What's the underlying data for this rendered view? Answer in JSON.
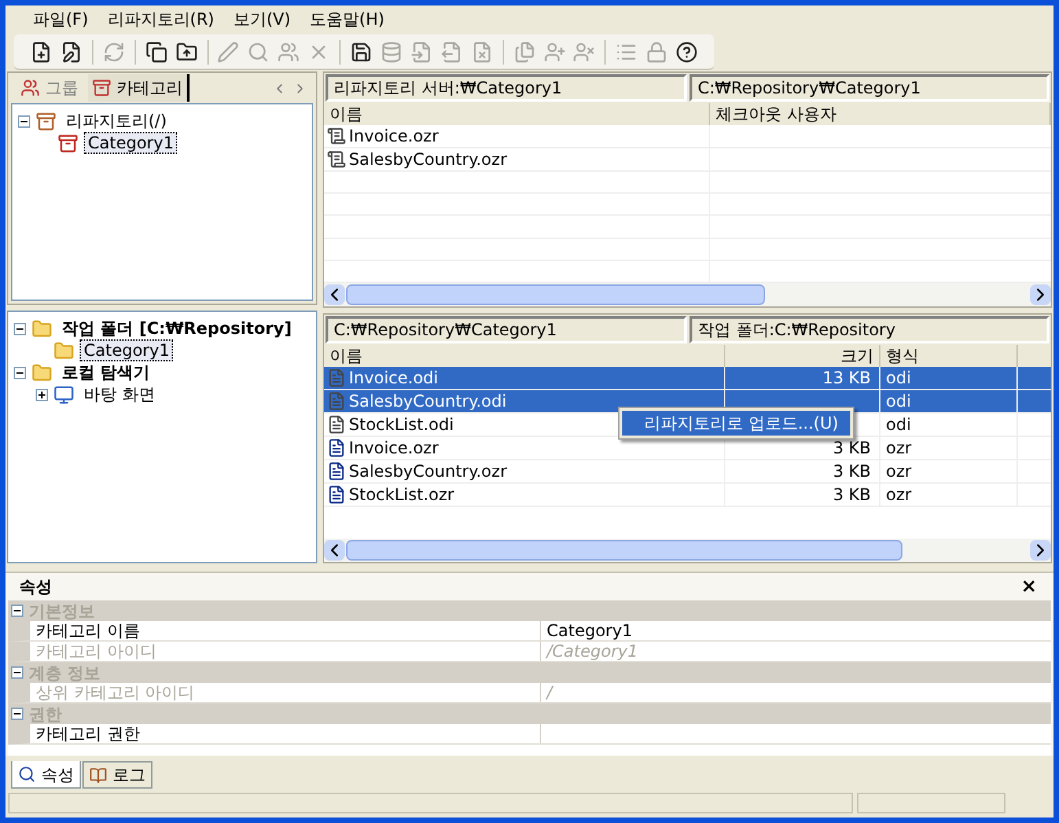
{
  "menu": [
    "파일(F)",
    "리파지토리(R)",
    "보기(V)",
    "도움말(H)"
  ],
  "toolbar": [
    [
      {
        "kind": "new",
        "disabled": false
      },
      {
        "kind": "edit",
        "disabled": false
      }
    ],
    [
      {
        "kind": "refresh",
        "disabled": true
      }
    ],
    [
      {
        "kind": "copy",
        "disabled": false
      },
      {
        "kind": "upload",
        "disabled": false
      }
    ],
    [
      {
        "kind": "pen",
        "disabled": true
      },
      {
        "kind": "find",
        "disabled": true
      },
      {
        "kind": "users",
        "disabled": true
      },
      {
        "kind": "delete",
        "disabled": true
      }
    ],
    [
      {
        "kind": "save",
        "disabled": false
      },
      {
        "kind": "database",
        "disabled": true
      },
      {
        "kind": "import",
        "disabled": true
      },
      {
        "kind": "export",
        "disabled": true
      },
      {
        "kind": "remove",
        "disabled": true
      }
    ],
    [
      {
        "kind": "files",
        "disabled": true
      },
      {
        "kind": "adduser",
        "disabled": true
      },
      {
        "kind": "removeuser",
        "disabled": true
      }
    ],
    [
      {
        "kind": "list",
        "disabled": true
      },
      {
        "kind": "lock",
        "disabled": true
      },
      {
        "kind": "help",
        "disabled": false
      }
    ]
  ],
  "left_tabs": [
    {
      "label": "그룹",
      "kind": "group",
      "selected": false
    },
    {
      "label": "카테고리",
      "kind": "category",
      "selected": true
    }
  ],
  "repository_tree": [
    {
      "label": "리파지토리(/)",
      "kind": "repository",
      "expanded": true,
      "selected": false,
      "children": [
        {
          "label": "Category1",
          "kind": "category",
          "selected": true
        }
      ]
    }
  ],
  "local_tree": [
    {
      "label": "작업 폴더 [C:₩Repository]",
      "kind": "folder",
      "bold": true,
      "expanded": true,
      "selected": false,
      "children": [
        {
          "label": "Category1",
          "kind": "folder",
          "selected": true
        }
      ]
    },
    {
      "label": "로컬 탐색기",
      "kind": "folder",
      "bold": true,
      "expanded": true,
      "selected": false,
      "children": [
        {
          "label": "바탕 화면",
          "kind": "desktop",
          "expanded": false,
          "selected": false
        }
      ]
    }
  ],
  "server_pane": {
    "path": "리파지토리 서버:₩Category1",
    "local_path": "C:₩Repository₩Category1",
    "columns": [
      "이름",
      "체크아웃 사용자"
    ],
    "rows": [
      {
        "name": "Invoice.ozr",
        "selected": false
      },
      {
        "name": "SalesbyCountry.ozr",
        "selected": false
      }
    ]
  },
  "local_pane": {
    "path": "C:₩Repository₩Category1",
    "work_folder": "작업 폴더:C:₩Repository",
    "columns": [
      "이름",
      "크기",
      "형식"
    ],
    "rows": [
      {
        "name": "Invoice.odi",
        "size": "13 KB",
        "type": "odi",
        "kind": "odi",
        "selected": true
      },
      {
        "name": "SalesbyCountry.odi",
        "type": "odi",
        "kind": "odi",
        "selected": true
      },
      {
        "name": "StockList.odi",
        "type": "odi",
        "kind": "odi",
        "selected": false
      },
      {
        "name": "Invoice.ozr",
        "size": "3 KB",
        "type": "ozr",
        "kind": "ozr",
        "selected": false
      },
      {
        "name": "SalesbyCountry.ozr",
        "size": "3 KB",
        "type": "ozr",
        "kind": "ozr",
        "selected": false
      },
      {
        "name": "StockList.ozr",
        "size": "3 KB",
        "type": "ozr",
        "kind": "ozr",
        "selected": false
      }
    ],
    "context_menu": [
      "리파지토리로 업로드...(U)"
    ]
  },
  "properties": {
    "title": "속성",
    "close": "×",
    "groups": [
      {
        "label": "기본정보",
        "expanded": true,
        "rows": [
          {
            "name": "카테고리 이름",
            "value": "Category1",
            "disabled": false
          },
          {
            "name": "카테고리 아이디",
            "value": "/Category1",
            "disabled": true
          }
        ]
      },
      {
        "label": "계층 정보",
        "expanded": true,
        "rows": [
          {
            "name": "상위 카테고리 아이디",
            "value": "/",
            "disabled": true
          }
        ]
      },
      {
        "label": "권한",
        "expanded": true,
        "rows": [
          {
            "name": "카테고리 권한",
            "disabled": false
          }
        ]
      }
    ]
  },
  "bottom_tabs": [
    {
      "label": "속성",
      "kind": "properties",
      "selected": true
    },
    {
      "label": "로그",
      "kind": "log",
      "selected": false
    }
  ]
}
